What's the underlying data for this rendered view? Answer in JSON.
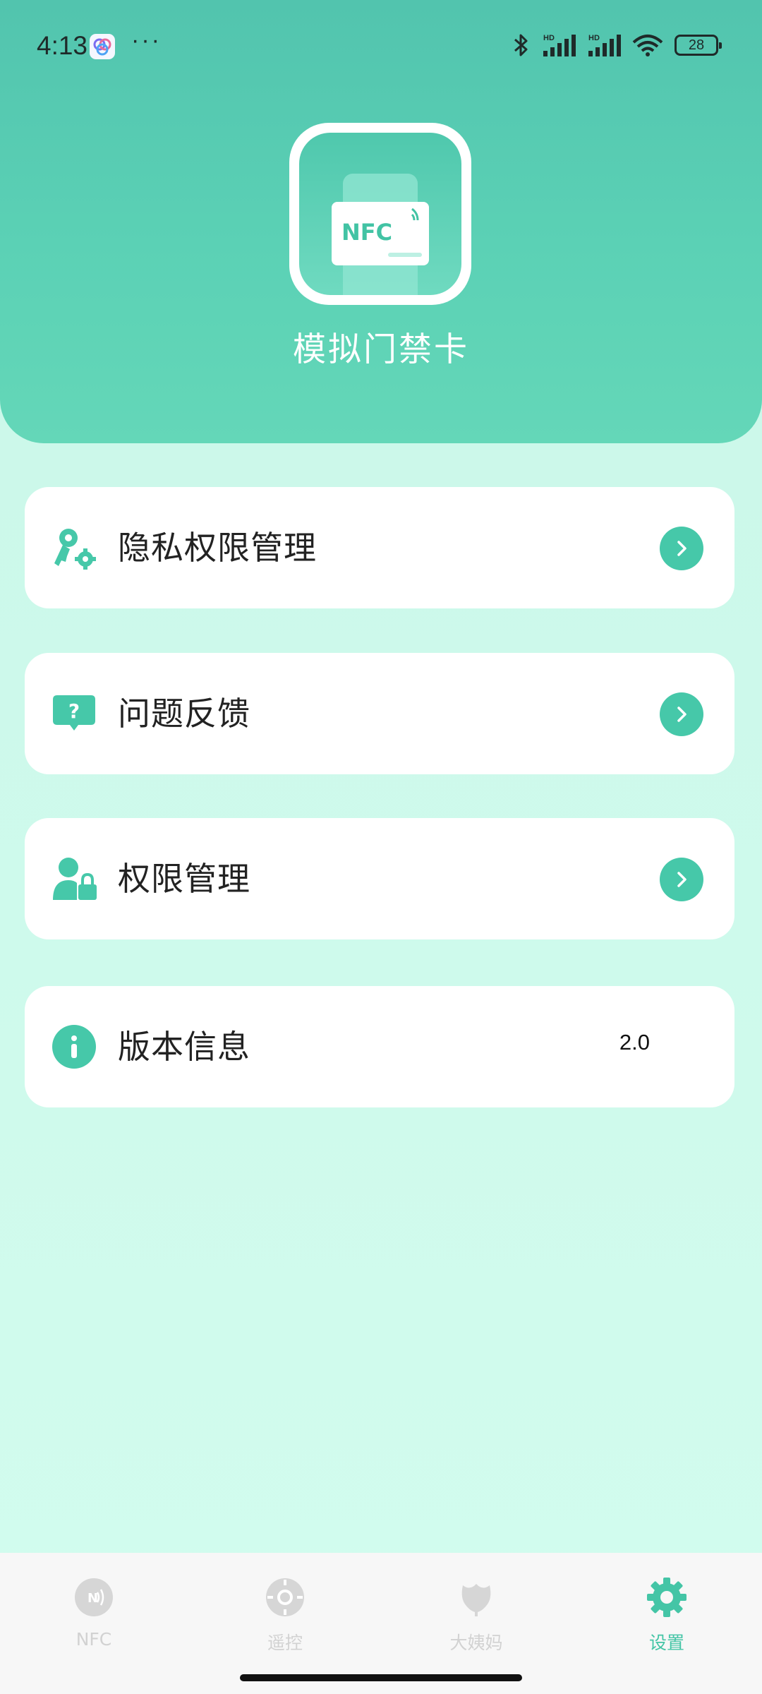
{
  "status_bar": {
    "time": "4:13",
    "more": "···",
    "battery": "28",
    "signal_badge": "HD"
  },
  "header": {
    "app_name": "模拟门禁卡",
    "logo_text": "NFC",
    "accent_color": "#46c8a9"
  },
  "menu": [
    {
      "label": "隐私权限管理",
      "icon": "key-gear-icon",
      "action": "chevron-right-icon"
    },
    {
      "label": "问题反馈",
      "icon": "question-bubble-icon",
      "action": "chevron-right-icon"
    },
    {
      "label": "权限管理",
      "icon": "user-lock-icon",
      "action": "chevron-right-icon"
    },
    {
      "label": "版本信息",
      "icon": "info-icon",
      "value": "2.0"
    }
  ],
  "bottom_nav": [
    {
      "label": "NFC",
      "icon": "nfc-icon",
      "active": false
    },
    {
      "label": "遥控",
      "icon": "remote-icon",
      "active": false
    },
    {
      "label": "大姨妈",
      "icon": "flower-icon",
      "active": false
    },
    {
      "label": "设置",
      "icon": "gear-icon",
      "active": true
    }
  ]
}
